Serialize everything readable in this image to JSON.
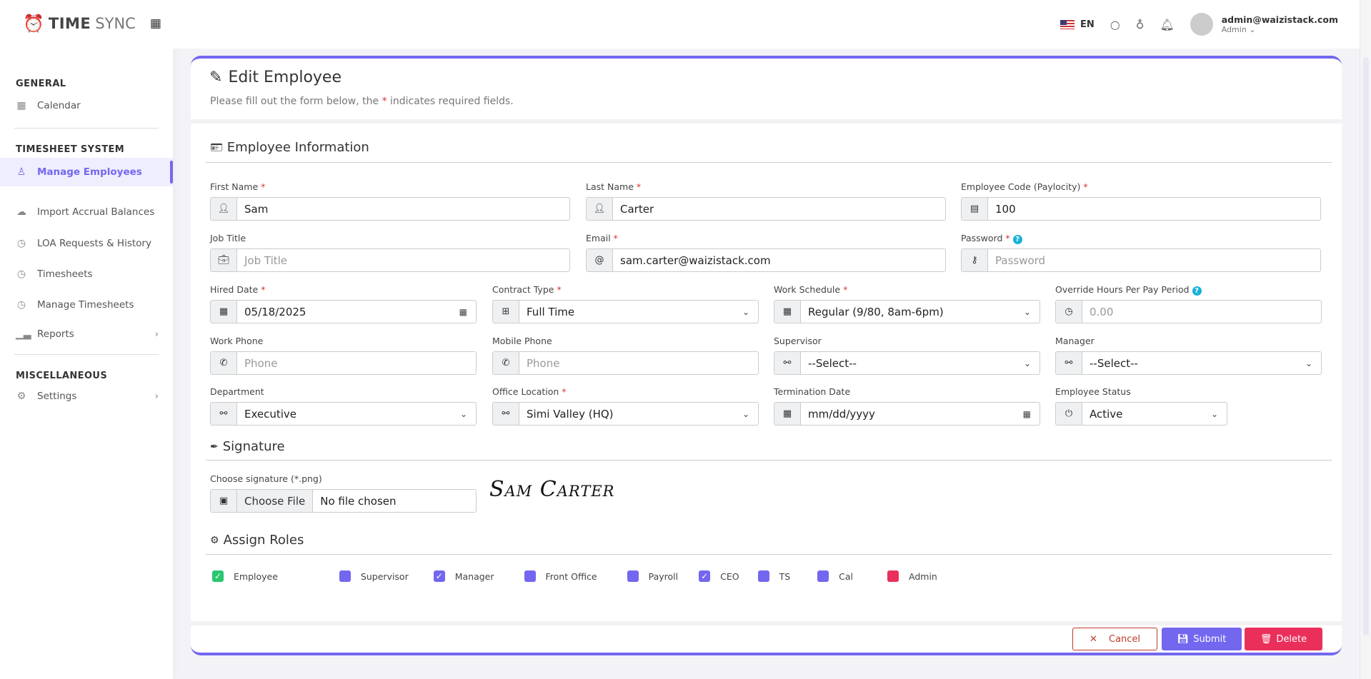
{
  "brand": {
    "name_bold": "TIME",
    "name_light": "SYNC"
  },
  "sidebar": {
    "sections": [
      {
        "title": "GENERAL",
        "items": [
          {
            "label": "Calendar",
            "icon": "calendar-icon"
          }
        ]
      },
      {
        "title": "TIMESHEET SYSTEM",
        "items": [
          {
            "label": "Manage Employees",
            "icon": "users-icon"
          },
          {
            "label": "Import Accrual Balances",
            "icon": "cloud-upload-icon"
          },
          {
            "label": "LOA Requests & History",
            "icon": "clock-icon"
          },
          {
            "label": "Timesheets",
            "icon": "clock-icon"
          },
          {
            "label": "Manage Timesheets",
            "icon": "clock-icon"
          },
          {
            "label": "Reports",
            "icon": "bar-chart-icon"
          }
        ]
      },
      {
        "title": "MISCELLANEOUS",
        "items": [
          {
            "label": "Settings",
            "icon": "gear-icon"
          }
        ]
      }
    ]
  },
  "header": {
    "lang": "EN",
    "user_email": "admin@waizistack.com",
    "user_role": "Admin"
  },
  "page": {
    "title": "Edit Employee",
    "subtitle_pre": "Please fill out the form below, the ",
    "subtitle_star": "*",
    "subtitle_post": " indicates required fields."
  },
  "sections": {
    "info": "Employee Information",
    "signature": "Signature",
    "roles": "Assign Roles"
  },
  "form": {
    "first_name": {
      "label": "First Name",
      "value": "Sam"
    },
    "last_name": {
      "label": "Last Name",
      "value": "Carter"
    },
    "code": {
      "label": "Employee Code (Paylocity)",
      "value": "100"
    },
    "job_title": {
      "label": "Job Title",
      "placeholder": "Job Title"
    },
    "email": {
      "label": "Email",
      "value": "sam.carter@waizistack.com"
    },
    "password": {
      "label": "Password",
      "placeholder": "Password"
    },
    "hired": {
      "label": "Hired Date",
      "value": "05/18/2025"
    },
    "contract": {
      "label": "Contract Type",
      "value": "Full Time"
    },
    "schedule": {
      "label": "Work Schedule",
      "value": "Regular (9/80, 8am-6pm)"
    },
    "override": {
      "label": "Override Hours Per Pay Period",
      "placeholder": "0.00"
    },
    "work_phone": {
      "label": "Work Phone",
      "placeholder": "Phone"
    },
    "mobile_phone": {
      "label": "Mobile Phone",
      "placeholder": "Phone"
    },
    "supervisor": {
      "label": "Supervisor",
      "value": "--Select--"
    },
    "manager": {
      "label": "Manager",
      "value": "--Select--"
    },
    "department": {
      "label": "Department",
      "value": "Executive"
    },
    "office": {
      "label": "Office Location",
      "value": "Simi Valley (HQ)"
    },
    "termination": {
      "label": "Termination Date",
      "value": "mm/dd/yyyy"
    },
    "status": {
      "label": "Employee Status",
      "value": "Active"
    },
    "signature": {
      "label": "Choose signature (*.png)",
      "button": "Choose File",
      "value": "No file chosen",
      "image_text": "Sam Carter"
    },
    "required_mark": "*"
  },
  "roles": [
    {
      "label": "Employee",
      "checked": true,
      "color": "#28c76f"
    },
    {
      "label": "Supervisor",
      "checked": false,
      "color": "#7367f0"
    },
    {
      "label": "Manager",
      "checked": true,
      "color": "#7367f0"
    },
    {
      "label": "Front Office",
      "checked": false,
      "color": "#7367f0"
    },
    {
      "label": "Payroll",
      "checked": false,
      "color": "#7367f0"
    },
    {
      "label": "CEO",
      "checked": true,
      "color": "#7367f0"
    },
    {
      "label": "TS",
      "checked": false,
      "color": "#7367f0"
    },
    {
      "label": "Cal",
      "checked": false,
      "color": "#7367f0"
    },
    {
      "label": "Admin",
      "checked": false,
      "color": "#ea2f5a"
    }
  ],
  "actions": {
    "cancel": "Cancel",
    "submit": "Submit",
    "delete": "Delete"
  }
}
